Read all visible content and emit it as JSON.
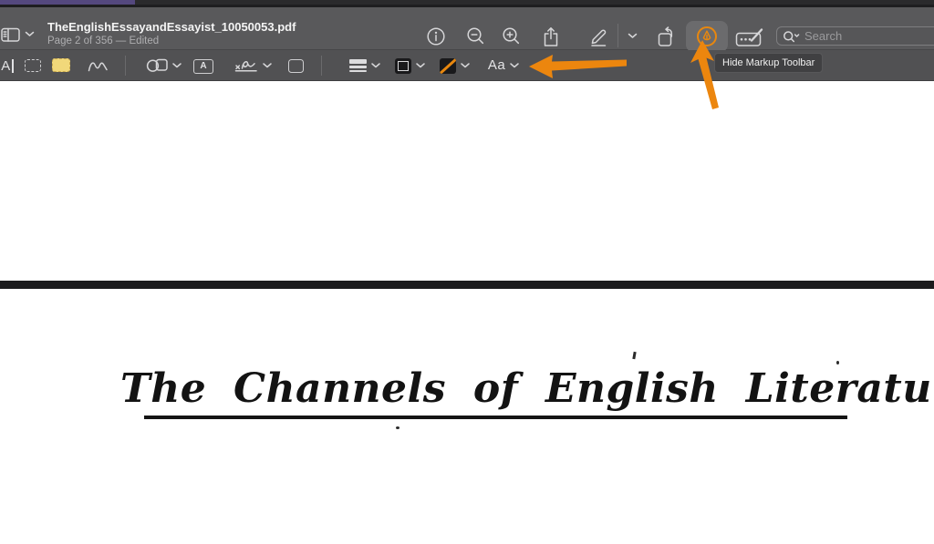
{
  "window": {
    "title": "TheEnglishEssayandEssayist_10050053.pdf",
    "subtitle": "Page 2 of 356 — Edited"
  },
  "titlebar": {
    "search_placeholder": "Search",
    "icons": [
      "sidebar-icon",
      "chevron-down-icon",
      "info-icon",
      "zoom-out-icon",
      "zoom-in-icon",
      "share-icon",
      "markup-pen-icon",
      "chevron-down-icon",
      "rotate-left-icon",
      "markup-toolbar-toggle-icon",
      "fill-and-sign-icon",
      "search-icon"
    ]
  },
  "markup_toolbar": {
    "tools": [
      "text-selection",
      "rectangular-selection",
      "redact",
      "sketch",
      "shapes",
      "text-box",
      "signature",
      "note",
      "shape-style",
      "border-color",
      "fill-color",
      "text-style"
    ],
    "glyphs": {
      "text_select": "A",
      "text_box": "A",
      "text_style": "Aa"
    }
  },
  "tooltip": {
    "text": "Hide Markup Toolbar"
  },
  "document": {
    "heading": "The Channels of English Literature"
  },
  "annotations": {
    "arrow_color": "#EC860E",
    "count": 2
  },
  "colors": {
    "titlebar_bg": "#59595B",
    "markup_toolbar_bg": "#515153",
    "active_button_bg": "#6B6B6D",
    "accent_orange": "#E8870E",
    "redact_yellow": "#F1D87A",
    "scan_bar": "#1B1B1D",
    "menu_strip_purple": "#54487E",
    "page_bg": "#FFFFFF"
  }
}
